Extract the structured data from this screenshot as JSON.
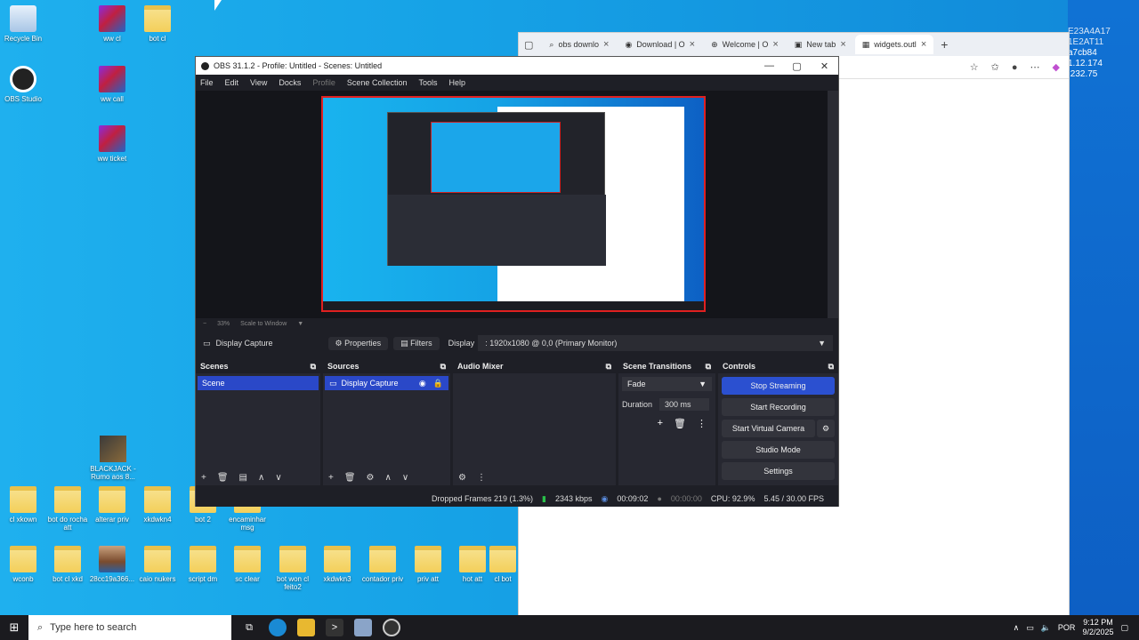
{
  "desktop": {
    "icons_left": [
      {
        "label": "Recycle Bin",
        "kind": "recycle"
      },
      {
        "label": "OBS Studio",
        "kind": "obs"
      }
    ],
    "icons_col2": [
      {
        "label": "ww cl",
        "kind": "winrar"
      },
      {
        "label": "ww call",
        "kind": "winrar"
      },
      {
        "label": "ww ticket",
        "kind": "winrar"
      }
    ],
    "icon_botcl": "bot cl",
    "icon_blackjack": "BLACKJACK - Rumo aos 8...",
    "row1": [
      "cl xkown",
      "bot do rocha att",
      "alterar priv",
      "xkdwkn4",
      "bot 2",
      "encaminhar msg"
    ],
    "row2": [
      "wconb",
      "bot cl xkd",
      "28cc19a366...",
      "caio nukers",
      "script dm",
      "sc clear",
      "bot won cl feito2",
      "xkdwkn3",
      "contador priv",
      "priv att",
      "hot att",
      "cl bot"
    ]
  },
  "ip_info": {
    "line1": "E23A4A17 1E2AT11",
    "line2": "a7cb84",
    "line3": "1.12.174",
    "line4": ".232.75"
  },
  "browser": {
    "tabs": [
      {
        "label": "obs downlo",
        "icon": "search-icon"
      },
      {
        "label": "Download | O",
        "icon": "obs-icon"
      },
      {
        "label": "Welcome | O",
        "icon": "globe-icon"
      },
      {
        "label": "New tab",
        "icon": "tab-icon"
      },
      {
        "label": "widgets.outl",
        "icon": "widgets-icon"
      }
    ]
  },
  "obs": {
    "title": "OBS 31.1.2 - Profile: Untitled - Scenes: Untitled",
    "menu": [
      "File",
      "Edit",
      "View",
      "Docks",
      "Profile",
      "Scene Collection",
      "Tools",
      "Help"
    ],
    "zoom": "33%",
    "zoom_mode": "Scale to Window",
    "source_name": "Display Capture",
    "properties": "Properties",
    "filters": "Filters",
    "display_label": "Display",
    "display_value": ": 1920x1080 @ 0,0 (Primary Monitor)",
    "docks": {
      "scenes": "Scenes",
      "sources": "Sources",
      "audio_mixer": "Audio Mixer",
      "scene_transitions": "Scene Transitions",
      "controls": "Controls"
    },
    "scene_item": "Scene",
    "source_item": "Display Capture",
    "transition": "Fade",
    "duration_label": "Duration",
    "duration_value": "300 ms",
    "controls": {
      "stop_streaming": "Stop Streaming",
      "start_recording": "Start Recording",
      "start_virtual_camera": "Start Virtual Camera",
      "studio_mode": "Studio Mode",
      "settings": "Settings"
    },
    "status": {
      "dropped": "Dropped Frames 219 (1.3%)",
      "bitrate": "2343 kbps",
      "stream_time": "00:09:02",
      "rec_time": "00:00:00",
      "cpu": "CPU: 92.9%",
      "fps": "5.45 / 30.00 FPS"
    }
  },
  "taskbar": {
    "search_placeholder": "Type here to search",
    "lang": "POR",
    "time": "9:12 PM",
    "date": "9/2/2025"
  }
}
